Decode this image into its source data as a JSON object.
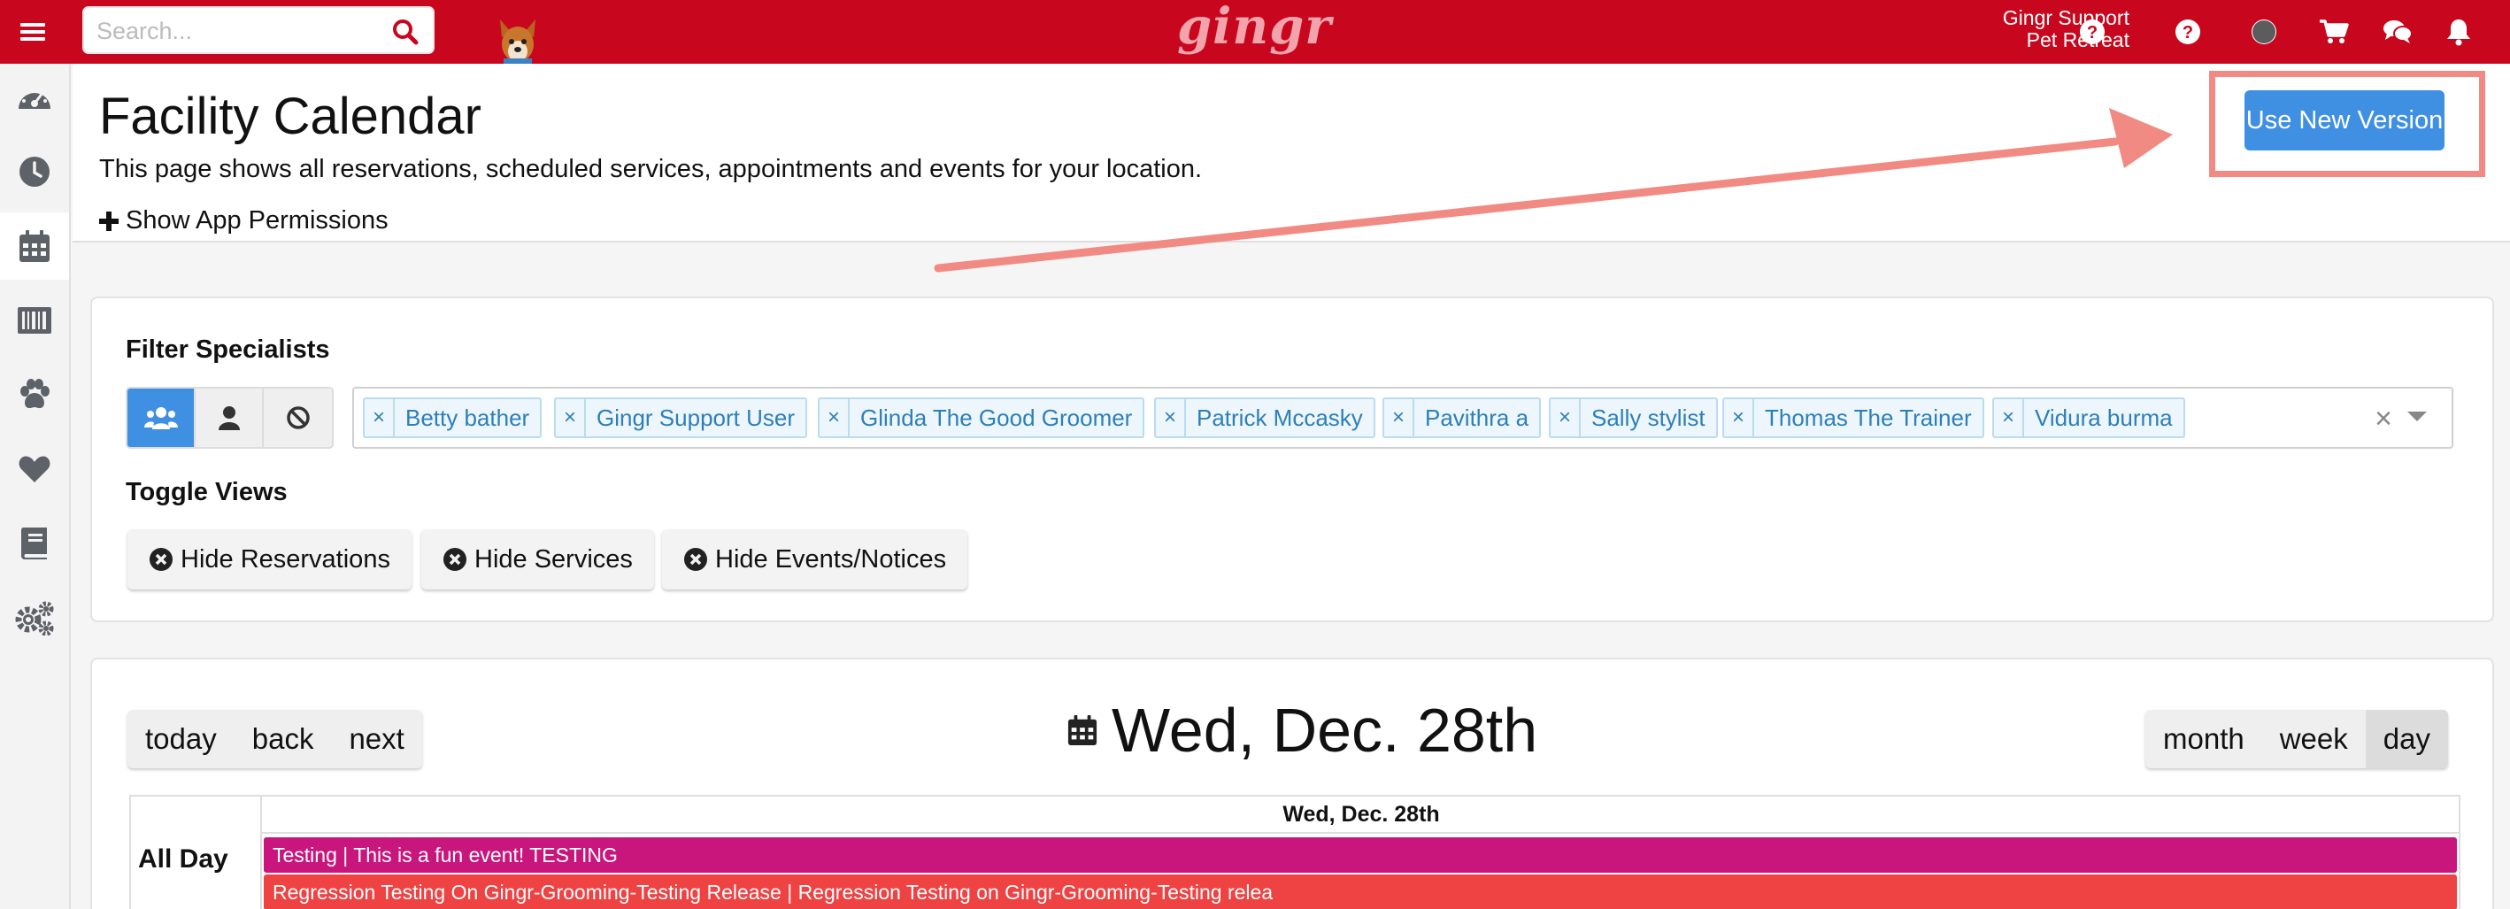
{
  "topbar": {
    "search_placeholder": "Search...",
    "logo_text": "gingr",
    "account_name": "Gingr Support",
    "account_location": "Pet Retreat"
  },
  "header": {
    "title": "Facility Calendar",
    "description": "This page shows all reservations, scheduled services, appointments and events for your location.",
    "permissions_toggle": "Show App Permissions",
    "new_version_button": "Use New Version"
  },
  "filters": {
    "specialists_label": "Filter Specialists",
    "specialists": [
      "Betty bather",
      "Gingr Support User",
      "Glinda The Good Groomer",
      "Patrick Mccasky",
      "Pavithra a",
      "Sally stylist",
      "Thomas The Trainer",
      "Vidura burma"
    ],
    "toggle_views_label": "Toggle Views",
    "views": [
      "Hide Reservations",
      "Hide Services",
      "Hide Events/Notices"
    ]
  },
  "calendar": {
    "nav": [
      "today",
      "back",
      "next"
    ],
    "title": "Wed, Dec. 28th",
    "views": [
      "month",
      "week",
      "day"
    ],
    "active_view": "day",
    "column_header": "Wed, Dec. 28th",
    "all_day_label": "All Day",
    "events": [
      "Testing | This is a fun event! TESTING",
      "Regression Testing On Gingr-Grooming-Testing Release | Regression Testing on Gingr-Grooming-Testing relea"
    ]
  },
  "colors": {
    "brand_red": "#c8071e",
    "primary_blue": "#3f8fe3",
    "annotation_salmon": "#f28a84",
    "event_magenta": "#c9167c",
    "event_red": "#ef4242"
  }
}
